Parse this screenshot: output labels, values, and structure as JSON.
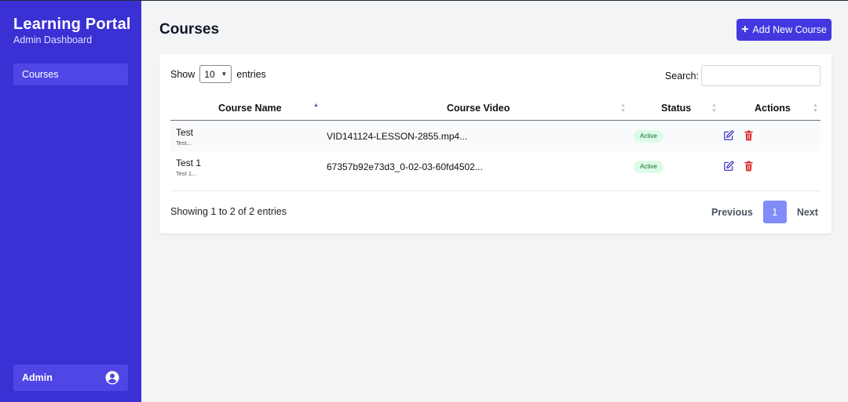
{
  "sidebar": {
    "brand_title": "Learning Portal",
    "brand_subtitle": "Admin Dashboard",
    "nav": [
      {
        "label": "Courses"
      }
    ],
    "user_label": "Admin",
    "user_icon": "user-circle-icon"
  },
  "header": {
    "title": "Courses",
    "add_button_label": "Add New Course",
    "add_button_icon": "plus-icon"
  },
  "table_controls": {
    "show_label": "Show",
    "entries_value": "10",
    "entries_label": "entries",
    "search_label": "Search:",
    "search_value": ""
  },
  "columns": [
    "Course Name",
    "Course Video",
    "Status",
    "Actions"
  ],
  "rows": [
    {
      "name": "Test",
      "description": "Test...",
      "video": "VID141124-LESSON-2855.mp4...",
      "status": "Active"
    },
    {
      "name": "Test 1",
      "description": "Test 1...",
      "video": "67357b92e73d3_0-02-03-60fd4502...",
      "status": "Active"
    }
  ],
  "footer": {
    "info": "Showing 1 to 2 of 2 entries",
    "previous_label": "Previous",
    "page": "1",
    "next_label": "Next"
  },
  "colors": {
    "sidebar_bg": "#3b30d4",
    "accent": "#4338e0",
    "active_page": "#818cf8",
    "status_active_bg": "#dcfce7",
    "status_active_text": "#166534",
    "delete_icon": "#dc2626",
    "edit_icon": "#4338ca"
  }
}
